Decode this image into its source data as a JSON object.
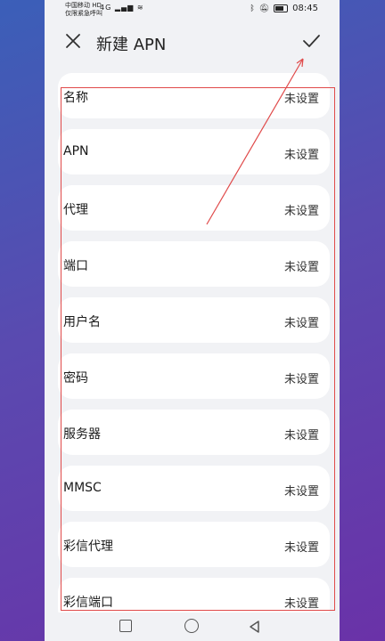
{
  "statusbar": {
    "carrier_line1": "中国移动 HD",
    "carrier_line2": "仅限紧急呼叫",
    "signal": "4G",
    "time": "08:45"
  },
  "appbar": {
    "title": "新建 APN"
  },
  "items": [
    {
      "label": "名称",
      "value": "未设置"
    },
    {
      "label": "APN",
      "value": "未设置"
    },
    {
      "label": "代理",
      "value": "未设置"
    },
    {
      "label": "端口",
      "value": "未设置"
    },
    {
      "label": "用户名",
      "value": "未设置"
    },
    {
      "label": "密码",
      "value": "未设置"
    },
    {
      "label": "服务器",
      "value": "未设置"
    },
    {
      "label": "MMSC",
      "value": "未设置"
    },
    {
      "label": "彩信代理",
      "value": "未设置"
    },
    {
      "label": "彩信端口",
      "value": "未设置"
    }
  ],
  "icons": {
    "close": "close-icon",
    "confirm": "check-icon",
    "nav_back": "square-icon",
    "nav_home": "circle-icon",
    "nav_recent": "triangle-back-icon"
  },
  "colors": {
    "annotation": "#e04a4a",
    "page_bg": "#f1f2f5",
    "row_bg": "#ffffff"
  }
}
